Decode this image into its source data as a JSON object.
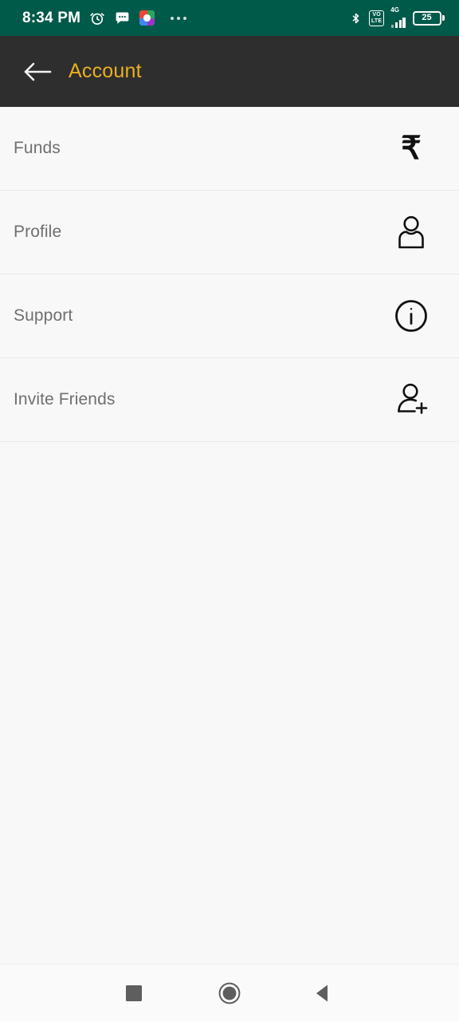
{
  "status_bar": {
    "time": "8:34 PM",
    "background_color": "#005A49",
    "icons_left": [
      "alarm-clock-icon",
      "messages-icon",
      "photos-app-icon",
      "notification-overflow-dots"
    ],
    "icons_right": [
      "bluetooth-icon",
      "volte-icon",
      "signal-4g-icon",
      "battery-icon"
    ],
    "volte_line1": "VO",
    "volte_line2": "LTE",
    "network_type": "4G",
    "battery_percent": "25",
    "signal_bars": 4
  },
  "app_bar": {
    "back_label": "back-arrow",
    "title": "Account",
    "title_color": "#E9B11F",
    "background_color": "#2E2E2E"
  },
  "menu": {
    "items": [
      {
        "label": "Funds",
        "icon": "rupee-icon",
        "glyph": "₹"
      },
      {
        "label": "Profile",
        "icon": "person-icon",
        "glyph": ""
      },
      {
        "label": "Support",
        "icon": "info-circle-icon",
        "glyph": ""
      },
      {
        "label": "Invite Friends",
        "icon": "person-add-icon",
        "glyph": ""
      }
    ]
  },
  "nav_bar": {
    "recents_label": "Recents",
    "home_label": "Home",
    "back_label": "Back",
    "background_color": "#FAFAFA",
    "icon_color": "#5E5E5E"
  }
}
